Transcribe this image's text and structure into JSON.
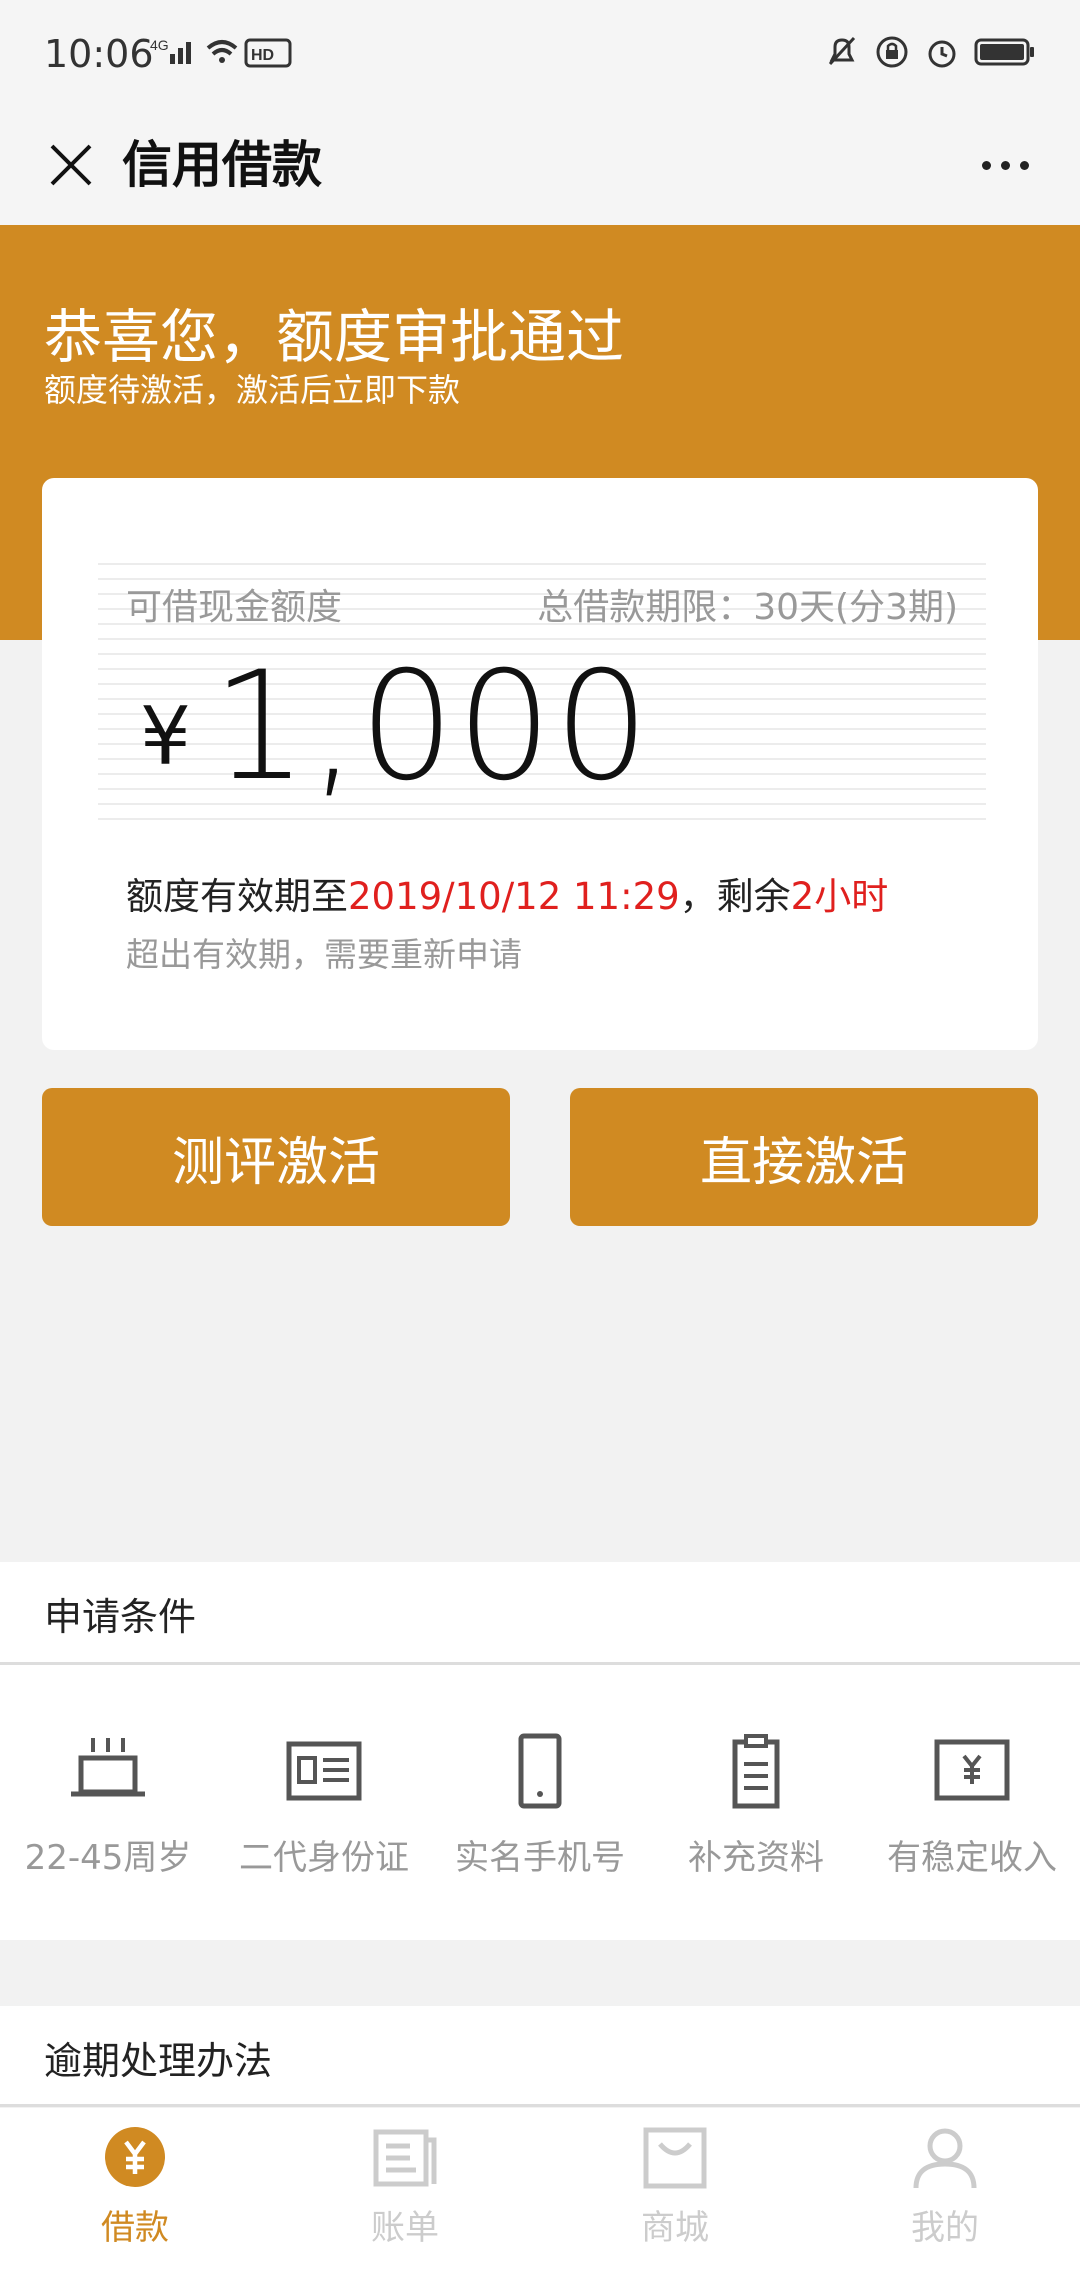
{
  "status": {
    "time": "10:06"
  },
  "header": {
    "title": "信用借款"
  },
  "hero": {
    "title": "恭喜您，额度审批通过",
    "subtitle": "额度待激活，激活后立即下款"
  },
  "card": {
    "label": "可借现金额度",
    "term": "总借款期限：30天(分3期)",
    "currency": "¥",
    "amount": "1,000",
    "validity_prefix": "额度有效期至",
    "validity_date": "2019/10/12 11:29",
    "validity_mid": "，剩余",
    "validity_remaining": "2小时",
    "validity_note": "超出有效期，需要重新申请"
  },
  "buttons": {
    "evaluate": "测评激活",
    "direct": "直接激活"
  },
  "conditions": {
    "header": "申请条件",
    "items": [
      {
        "label": "22-45周岁",
        "icon": "cake-icon"
      },
      {
        "label": "二代身份证",
        "icon": "id-card-icon"
      },
      {
        "label": "实名手机号",
        "icon": "phone-icon"
      },
      {
        "label": "补充资料",
        "icon": "clipboard-icon"
      },
      {
        "label": "有稳定收入",
        "icon": "income-icon"
      }
    ]
  },
  "overdue": {
    "header": "逾期处理办法"
  },
  "tabs": [
    {
      "label": "借款",
      "icon": "loan-icon",
      "active": true
    },
    {
      "label": "账单",
      "icon": "bill-icon",
      "active": false
    },
    {
      "label": "商城",
      "icon": "mall-icon",
      "active": false
    },
    {
      "label": "我的",
      "icon": "profile-icon",
      "active": false
    }
  ],
  "colors": {
    "accent": "#d08a22",
    "highlight": "#e0201e"
  }
}
